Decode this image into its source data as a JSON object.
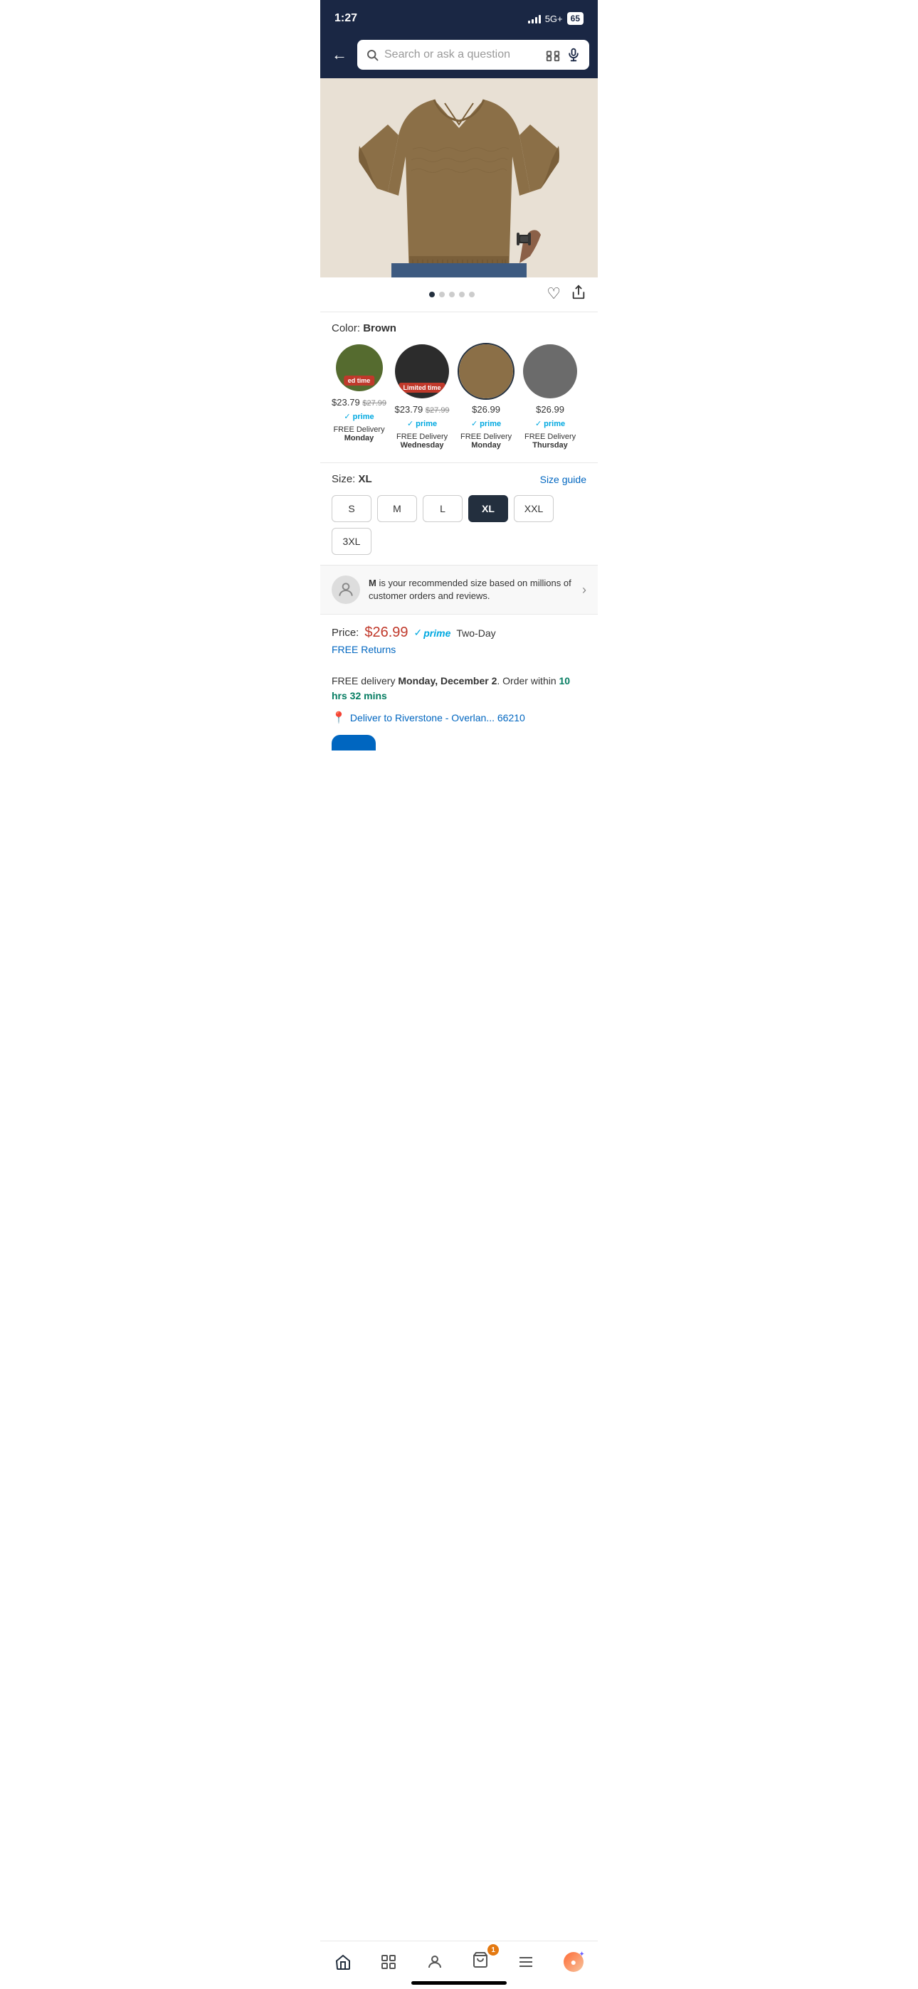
{
  "statusBar": {
    "time": "1:27",
    "signal": "5G+",
    "battery": "65"
  },
  "searchBar": {
    "placeholder": "Search or ask a question",
    "backLabel": "←"
  },
  "productImage": {
    "altText": "Brown sweater product image"
  },
  "imageDots": {
    "total": 5,
    "active": 0
  },
  "color": {
    "label": "Color:",
    "selectedColor": "Brown",
    "swatches": [
      {
        "id": "olive",
        "color": "#556b2f",
        "hasLimitedBadge": true,
        "badgeText": "ed time",
        "price": "$23.79",
        "origPrice": "$27.99",
        "hasPrime": true,
        "delivery": "FREE Delivery",
        "day": "Monday",
        "selected": false
      },
      {
        "id": "black",
        "color": "#2c2c2c",
        "hasLimitedBadge": true,
        "badgeText": "Limited time",
        "price": "$23.79",
        "origPrice": "$27.99",
        "hasPrime": true,
        "delivery": "FREE Delivery",
        "day": "Wednesday",
        "selected": false
      },
      {
        "id": "brown",
        "color": "#8b6f47",
        "hasLimitedBadge": false,
        "badgeText": "",
        "price": "$26.99",
        "origPrice": "",
        "hasPrime": true,
        "delivery": "FREE Delivery",
        "day": "Monday",
        "selected": true
      },
      {
        "id": "gray",
        "color": "#6b6b6b",
        "hasLimitedBadge": false,
        "badgeText": "",
        "price": "$26.99",
        "origPrice": "",
        "hasPrime": true,
        "delivery": "FREE Delivery",
        "day": "Thursday",
        "selected": false
      }
    ]
  },
  "size": {
    "label": "Size:",
    "selectedSize": "XL",
    "sizeGuideLabel": "Size guide",
    "options": [
      "S",
      "M",
      "L",
      "XL",
      "XXL",
      "3XL"
    ]
  },
  "recommendation": {
    "text": " is your recommended size based on millions of customer orders and reviews.",
    "sizeRec": "M",
    "chevron": "›"
  },
  "price": {
    "label": "Price:",
    "value": "$26.99",
    "primeLabel": "prime",
    "twoDayLabel": "Two-Day",
    "freeReturnsLabel": "FREE Returns"
  },
  "delivery": {
    "freeDeliveryPrefix": "FREE delivery ",
    "deliveryDate": "Monday, December 2",
    "orderWithinPrefix": ". Order within ",
    "countdown": "10 hrs 32 mins",
    "deliverToPrefix": "Deliver to Riverstone - Overlan... 66210"
  },
  "bottomNav": {
    "items": [
      {
        "id": "home",
        "icon": "⌂",
        "label": "Home",
        "active": true
      },
      {
        "id": "programs",
        "icon": "▦",
        "label": "Programs",
        "active": false
      },
      {
        "id": "account",
        "icon": "○",
        "label": "Account",
        "active": false
      },
      {
        "id": "cart",
        "icon": "⊡",
        "label": "Cart",
        "active": false,
        "count": "1"
      },
      {
        "id": "menu",
        "icon": "≡",
        "label": "Menu",
        "active": false
      }
    ],
    "cartCount": "1"
  }
}
